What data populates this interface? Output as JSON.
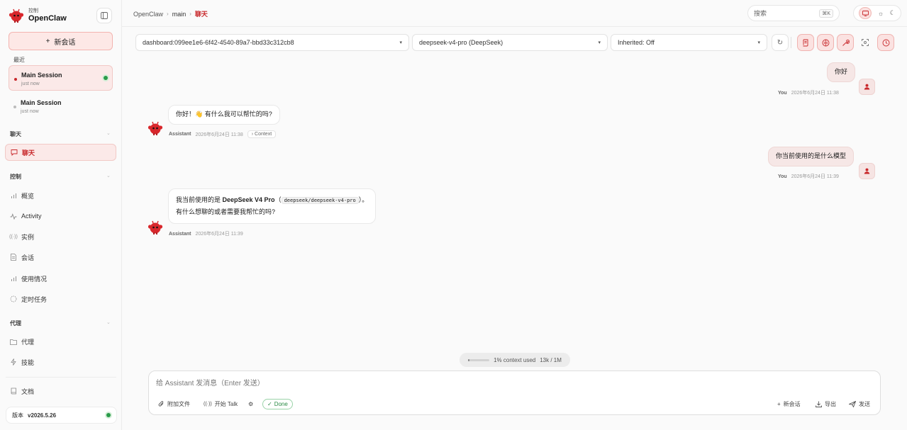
{
  "sidebar": {
    "brand_sub": "控制",
    "brand_name": "OpenClaw",
    "new_chat_label": "新会话",
    "recent_label": "最近",
    "sessions": [
      {
        "title": "Main Session",
        "time": "just now"
      },
      {
        "title": "Main Session",
        "time": "just now"
      }
    ],
    "groups": {
      "chat": "聊天",
      "control": "控制",
      "agent": "代理"
    },
    "items": {
      "chat": "聊天",
      "overview": "概览",
      "activity": "Activity",
      "instances": "实例",
      "sessions": "会话",
      "usage": "使用情况",
      "cron": "定时任务",
      "agents": "代理",
      "skills": "技能",
      "docs": "文档"
    },
    "version_label": "版本",
    "version_value": "v2026.5.26"
  },
  "topbar": {
    "crumbs": [
      "OpenClaw",
      "main",
      "聊天"
    ],
    "search_placeholder": "搜索",
    "search_shortcut": "⌘K"
  },
  "toolbar": {
    "session_select": "dashboard:099ee1e6-6f42-4540-89a7-bbd33c312cb8",
    "model_select": "deepseek-v4-pro (DeepSeek)",
    "thinking_select": "Inherited: Off"
  },
  "messages": {
    "m1": {
      "text": "你好",
      "who": "You",
      "time": "2026年6月24日 11:38"
    },
    "m2": {
      "text": "你好！👋 有什么我可以帮忙的吗?",
      "who": "Assistant",
      "time": "2026年6月24日 11:38",
      "context_label": "Context"
    },
    "m3": {
      "text": "你当前使用的是什么模型",
      "who": "You",
      "time": "2026年6月24日 11:39"
    },
    "m4": {
      "pre": "我当前使用的是 ",
      "bold": "DeepSeek V4 Pro",
      "paren_open": "（",
      "code": "deepseek/deepseek-v4-pro",
      "paren_close": "）。",
      "line2": "有什么想聊的或者需要我帮忙的吗?",
      "who": "Assistant",
      "time": "2026年6月24日 11:39"
    }
  },
  "context_usage": {
    "text": "1% context used",
    "tokens": "13k / 1M",
    "fraction": 0.01
  },
  "composer": {
    "placeholder": "给 Assistant 发消息（Enter 发送）",
    "attach": "附加文件",
    "talk": "开始 Talk",
    "done": "Done",
    "new_session": "新会话",
    "export": "导出",
    "send": "发送"
  },
  "colors": {
    "accent": "#c8282b",
    "accent_soft": "#fbe9e8",
    "online": "#2a9b4a"
  },
  "icons": [
    "mascot-logo",
    "panel-icon",
    "plus-icon",
    "chat-icon",
    "bar-chart-icon",
    "pulse-icon",
    "radio-icon",
    "document-icon",
    "cron-icon",
    "folder-icon",
    "sparkle-icon",
    "book-icon",
    "monitor-icon",
    "sun-icon",
    "moon-icon",
    "refresh-icon",
    "scroll-icon",
    "brain-icon",
    "wrench-icon",
    "focus-icon",
    "clock-icon",
    "user-icon",
    "paperclip-icon",
    "gear-icon",
    "download-icon",
    "send-icon"
  ]
}
